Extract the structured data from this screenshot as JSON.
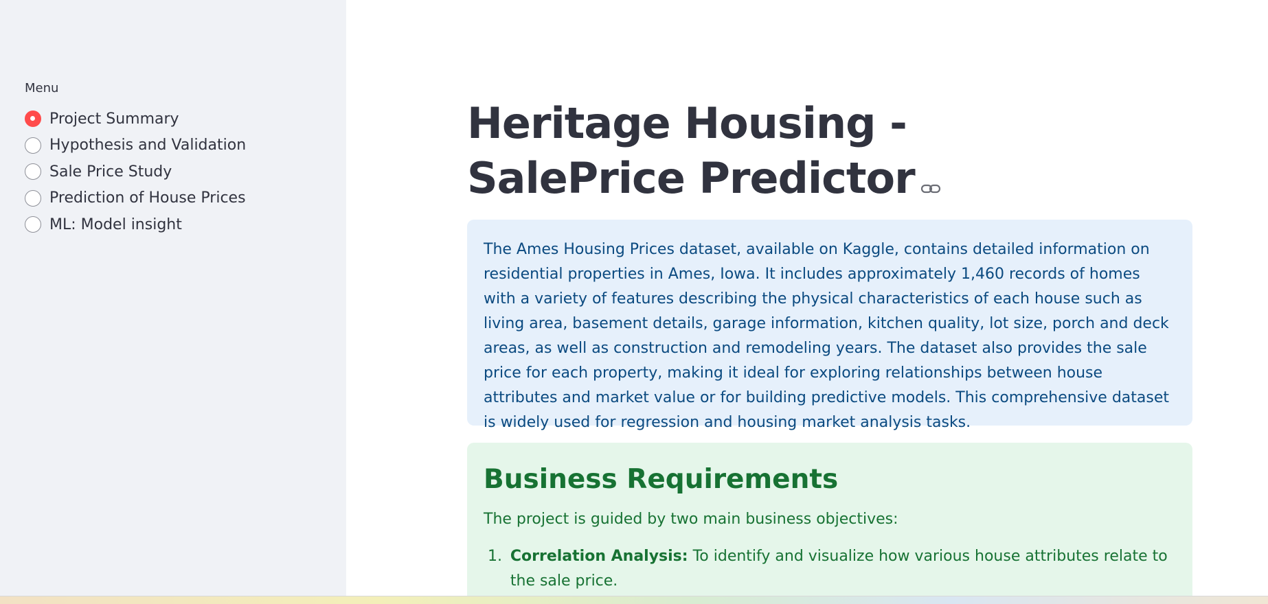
{
  "sidebar": {
    "menu_label": "Menu",
    "items": [
      {
        "label": "Project Summary",
        "selected": true
      },
      {
        "label": "Hypothesis and Validation",
        "selected": false
      },
      {
        "label": "Sale Price Study",
        "selected": false
      },
      {
        "label": "Prediction of House Prices",
        "selected": false
      },
      {
        "label": "ML: Model insight",
        "selected": false
      }
    ]
  },
  "main": {
    "title": "Heritage Housing - SalePrice Predictor",
    "info_text": "The Ames Housing Prices dataset, available on Kaggle, contains detailed information on residential properties in Ames, Iowa. It includes approximately 1,460 records of homes with a variety of features describing the physical characteristics of each house such as living area, basement details, garage information, kitchen quality, lot size, porch and deck areas, as well as construction and remodeling years. The dataset also provides the sale price for each property, making it ideal for exploring relationships between house attributes and market value or for building predictive models. This comprehensive dataset is widely used for regression and housing market analysis tasks.",
    "business": {
      "heading": "Business Requirements",
      "intro": "The project is guided by two main business objectives:",
      "items": [
        {
          "number": "1.",
          "label": "Correlation Analysis:",
          "text": " To identify and visualize how various house attributes relate to the sale price."
        }
      ]
    }
  },
  "colors": {
    "accent": "#ff4b4b",
    "sidebar_bg": "#f0f2f6",
    "info_bg": "#e6f0fb",
    "info_text": "#0b4a80",
    "success_bg": "#e5f6ea",
    "success_text": "#177233"
  }
}
